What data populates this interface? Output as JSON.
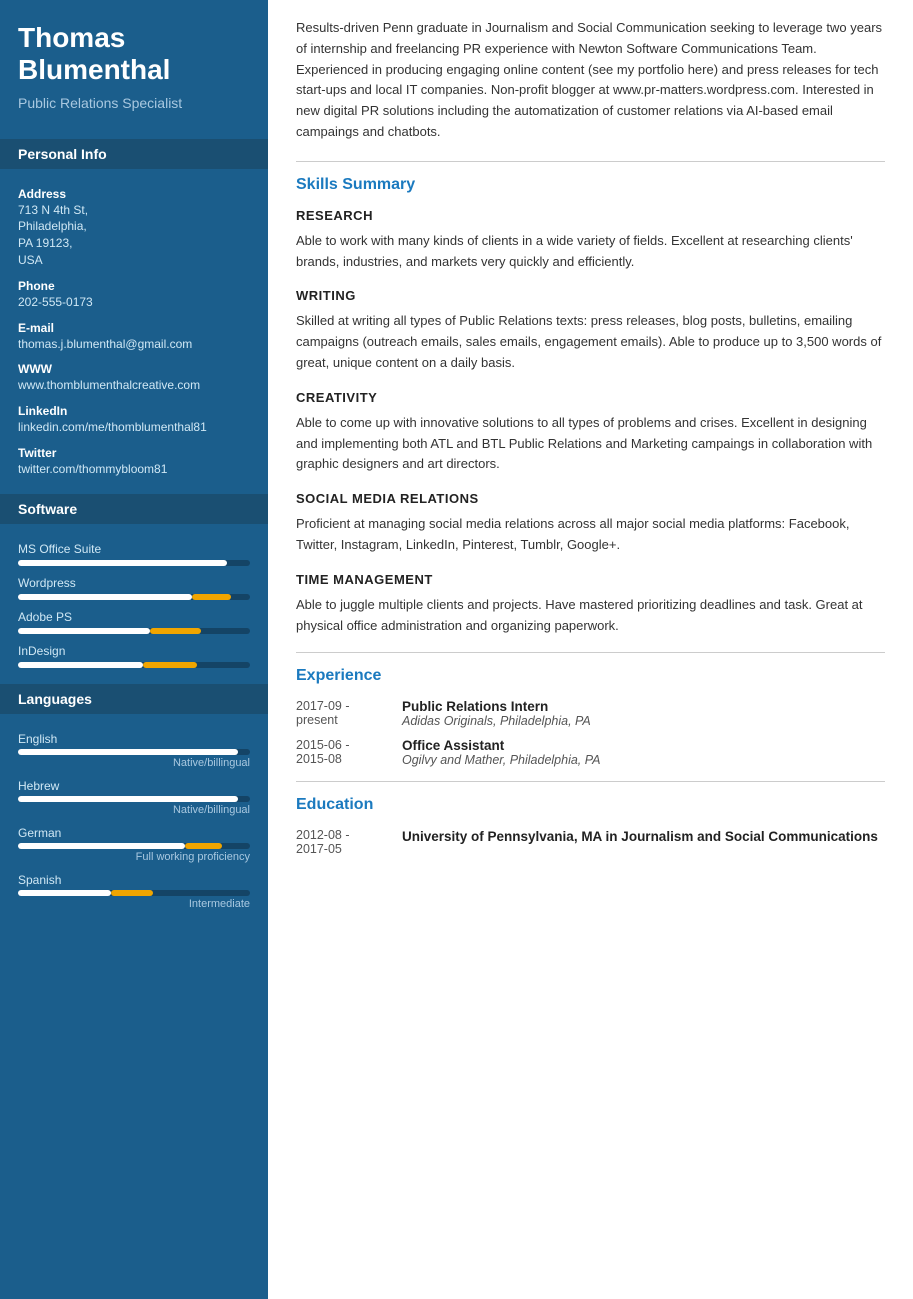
{
  "sidebar": {
    "name": "Thomas Blumenthal",
    "title": "Public Relations Specialist",
    "sections": {
      "personal_info": "Personal Info",
      "software": "Software",
      "languages": "Languages"
    },
    "personal": {
      "address_label": "Address",
      "address_value": "713 N 4th St,\nPhiladelphia,\nPA 19123,\nUSA",
      "phone_label": "Phone",
      "phone_value": "202-555-0173",
      "email_label": "E-mail",
      "email_value": "thomas.j.blumenthal@gmail.com",
      "www_label": "WWW",
      "www_value": "www.thomblumenthalcreative.com",
      "linkedin_label": "LinkedIn",
      "linkedin_value": "linkedin.com/me/thomblumenthal81",
      "twitter_label": "Twitter",
      "twitter_value": "twitter.com/thommybloom81"
    },
    "software": [
      {
        "name": "MS Office Suite",
        "fill_pct": 90,
        "fill2_pct": 0,
        "fill2_start": 0
      },
      {
        "name": "Wordpress",
        "fill_pct": 75,
        "fill2_pct": 17,
        "fill2_start": 75
      },
      {
        "name": "Adobe PS",
        "fill_pct": 58,
        "fill2_pct": 22,
        "fill2_start": 58
      },
      {
        "name": "InDesign",
        "fill_pct": 55,
        "fill2_pct": 24,
        "fill2_start": 55
      }
    ],
    "languages": [
      {
        "name": "English",
        "fill_pct": 95,
        "level": "Native/billingual"
      },
      {
        "name": "Hebrew",
        "fill_pct": 95,
        "level": "Native/billingual"
      },
      {
        "name": "German",
        "fill_pct": 72,
        "level": "Full working proficiency"
      },
      {
        "name": "Spanish",
        "fill_pct": 40,
        "level": "Intermediate"
      }
    ]
  },
  "main": {
    "summary": "Results-driven Penn graduate in Journalism and Social Communication seeking to leverage two years of internship and freelancing PR experience with Newton Software Communications Team. Experienced in producing engaging online content (see my portfolio here) and press releases for tech start-ups and local IT companies. Non-profit blogger at www.pr-matters.wordpress.com. Interested in new digital PR solutions including the automatization of customer relations via AI-based email campaings and chatbots.",
    "skills_title": "Skills Summary",
    "skills": [
      {
        "label": "RESEARCH",
        "desc": "Able to work with many kinds of clients in a wide variety of fields. Excellent at researching clients' brands, industries, and markets very quickly and efficiently."
      },
      {
        "label": "WRITING",
        "desc": "Skilled at writing all types of Public Relations texts: press releases, blog posts, bulletins, emailing campaigns (outreach emails, sales emails, engagement emails). Able to produce up to 3,500 words of great, unique content on a daily basis."
      },
      {
        "label": "CREATIVITY",
        "desc": "Able to come up with innovative solutions to all types of problems and crises. Excellent in designing and implementing both ATL and BTL Public Relations and Marketing campaings in collaboration with graphic designers and art directors."
      },
      {
        "label": "SOCIAL MEDIA RELATIONS",
        "desc": "Proficient at managing social media relations across all major social media platforms: Facebook, Twitter, Instagram, LinkedIn, Pinterest, Tumblr, Google+."
      },
      {
        "label": "TIME MANAGEMENT",
        "desc": "Able to juggle multiple clients and projects. Have mastered prioritizing deadlines and task. Great at physical office administration and organizing paperwork."
      }
    ],
    "experience_title": "Experience",
    "experience": [
      {
        "date": "2017-09 -\npresent",
        "title": "Public Relations Intern",
        "company": "Adidas Originals, Philadelphia, PA"
      },
      {
        "date": "2015-06 -\n2015-08",
        "title": "Office Assistant",
        "company": "Ogilvy and Mather, Philadelphia, PA"
      }
    ],
    "education_title": "Education",
    "education": [
      {
        "date": "2012-08 -\n2017-05",
        "degree": "University of Pennsylvania, MA in Journalism and Social Communications"
      }
    ]
  }
}
